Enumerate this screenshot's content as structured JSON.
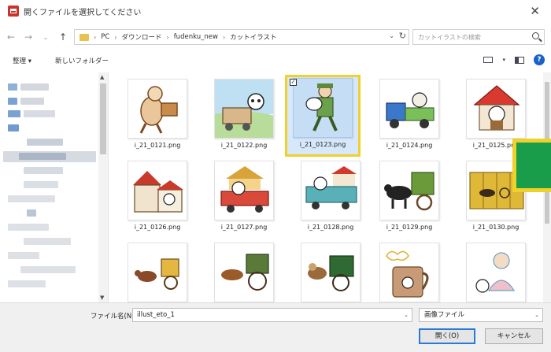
{
  "titlebar": {
    "title": "開くファイルを選択してください",
    "close": "✕"
  },
  "nav": {
    "back": "←",
    "forward": "→",
    "recent": "⌄",
    "up": "↑",
    "breadcrumb": [
      "PC",
      "ダウンロード",
      "fudenku_new",
      "カットイラスト"
    ],
    "separator": "›",
    "dropdown": "⌄",
    "refresh": "↻",
    "search_placeholder": "カットイラストの検索"
  },
  "toolbar": {
    "organize": "整理 ▾",
    "new_folder": "新しいフォルダー",
    "view_dropdown": "▾",
    "help": "?"
  },
  "files": [
    {
      "name": "i_21_0121.png",
      "icon": "cow-carrying-box"
    },
    {
      "name": "i_21_0122.png",
      "icon": "cow-in-cart"
    },
    {
      "name": "i_21_0123.png",
      "icon": "farmer-carrying-cow",
      "selected": true
    },
    {
      "name": "i_21_0124.png",
      "icon": "cow-truck"
    },
    {
      "name": "i_21_0125.png",
      "icon": "cow-house"
    },
    {
      "name": "i_21_0126.png",
      "icon": "barn-house"
    },
    {
      "name": "i_21_0127.png",
      "icon": "cow-in-car"
    },
    {
      "name": "i_21_0128.png",
      "icon": "cow-pickup-truck"
    },
    {
      "name": "i_21_0129.png",
      "icon": "cow-wagon"
    },
    {
      "name": "i_21_0130.png",
      "icon": "folding-screen-oxcart"
    },
    {
      "name": "",
      "icon": "ox-cart-small"
    },
    {
      "name": "",
      "icon": "ox-cart"
    },
    {
      "name": "",
      "icon": "ox-green-cart"
    },
    {
      "name": "",
      "icon": "milk-mug"
    },
    {
      "name": "",
      "icon": "woman-cow"
    }
  ],
  "bottom": {
    "filename_label": "ファイル名(N):",
    "filename_value": "illust_eto_1",
    "filetype_value": "画像ファイル",
    "open_label": "開く(O)",
    "cancel_label": "キャンセル",
    "dropdown": "⌄"
  },
  "colors": {
    "selection_border": "#f0d02a",
    "overlay": "#1a9d4b",
    "app_icon": "#c9332c",
    "help": "#1a63c6"
  }
}
